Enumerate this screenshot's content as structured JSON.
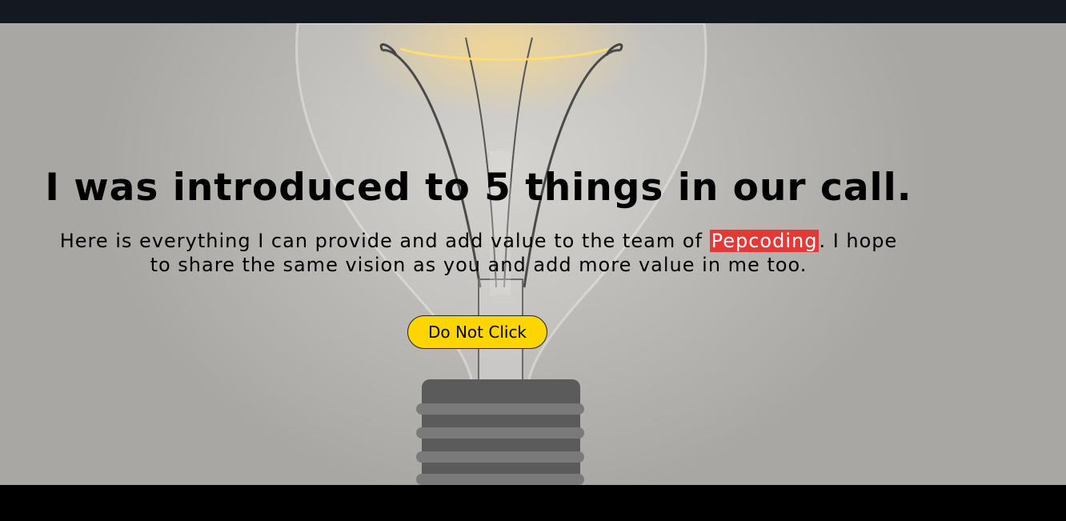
{
  "hero": {
    "headline": "I was introduced to 5 things in our call.",
    "paragraph_before": "Here is everything I can provide and add value to the team of ",
    "highlight": "Pepcoding",
    "paragraph_after": ". I hope to share the same vision as you and add more value in me too.",
    "button_label": "Do Not Click",
    "background_image": "lightbulb"
  },
  "colors": {
    "nav_bg": "#141821",
    "highlight_bg": "#e53935",
    "button_bg": "#ffd500",
    "footer_bg": "#000000"
  }
}
